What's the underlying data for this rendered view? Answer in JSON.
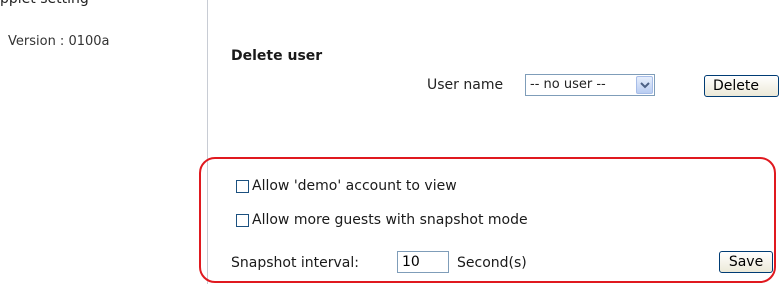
{
  "top_cut_text": "pplet setting",
  "sidebar": {
    "version": "Version : 0100a"
  },
  "delete_user": {
    "title": "Delete user",
    "user_name_label": "User name",
    "selected_user": "-- no user --",
    "delete_label": "Delete"
  },
  "guest_options": {
    "allow_demo_label": "Allow 'demo' account to view",
    "allow_demo_checked": false,
    "allow_guests_label": "Allow more guests with snapshot mode",
    "allow_guests_checked": false,
    "interval_label": "Snapshot interval:",
    "interval_value": "10",
    "interval_unit": "Second(s)",
    "save_label": "Save"
  },
  "colors": {
    "highlight": "#e0191f",
    "select_border": "#7f9db9"
  },
  "icons": {
    "select_arrow": "chevron-down-icon"
  }
}
